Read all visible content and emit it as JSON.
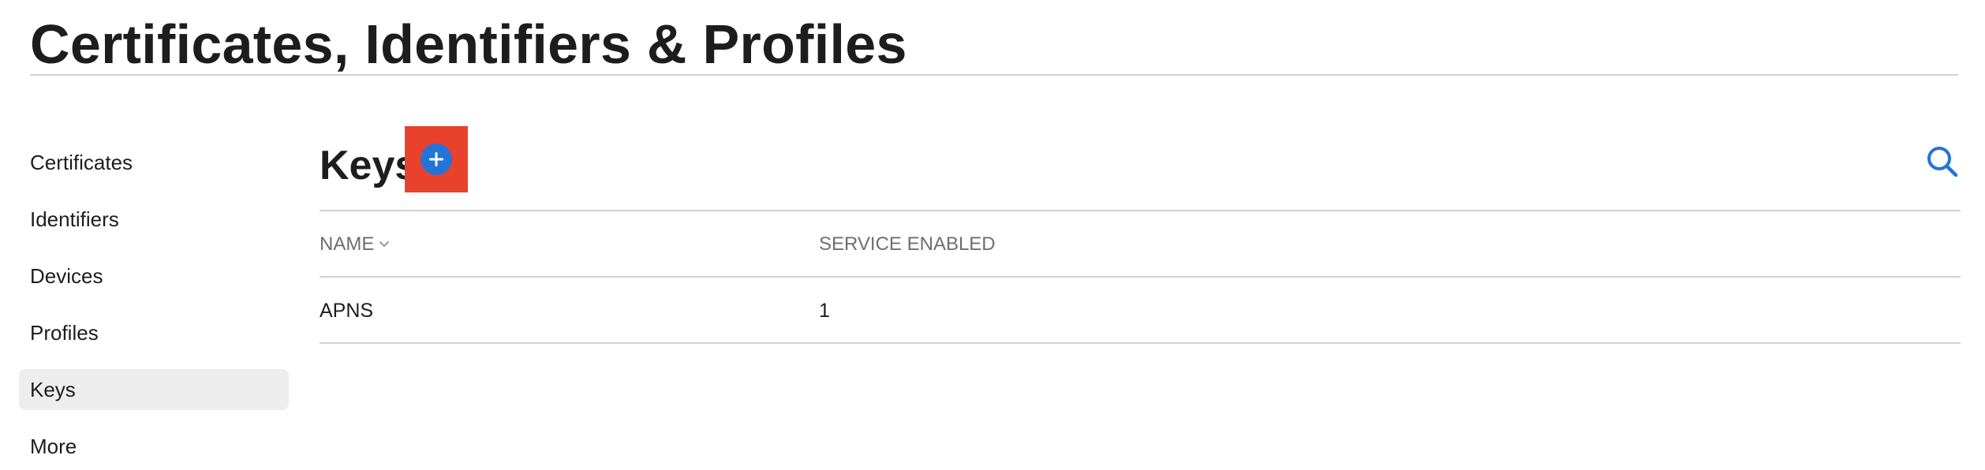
{
  "page": {
    "title": "Certificates, Identifiers & Profiles"
  },
  "sidebar": {
    "items": [
      {
        "label": "Certificates",
        "active": false
      },
      {
        "label": "Identifiers",
        "active": false
      },
      {
        "label": "Devices",
        "active": false
      },
      {
        "label": "Profiles",
        "active": false
      },
      {
        "label": "Keys",
        "active": true
      },
      {
        "label": "More",
        "active": false
      }
    ]
  },
  "main": {
    "section_title": "Keys",
    "add_icon": "plus-circle-icon",
    "search_icon": "search-icon",
    "table": {
      "columns": [
        {
          "label": "NAME",
          "sortable": true,
          "sort_icon": "chevron-down-icon"
        },
        {
          "label": "SERVICE ENABLED"
        }
      ],
      "rows": [
        {
          "name": "APNS",
          "service_enabled": "1"
        }
      ]
    }
  },
  "colors": {
    "accent": "#2374d6",
    "highlight": "#e8412c",
    "active_bg": "#ededed",
    "divider": "#d2d2d7",
    "muted_text": "#6e6e73"
  }
}
